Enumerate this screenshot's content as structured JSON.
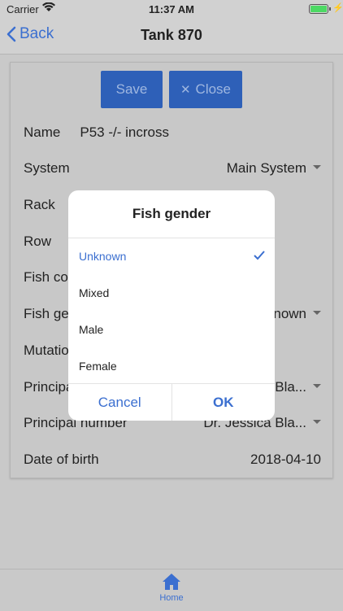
{
  "status": {
    "carrier": "Carrier",
    "time": "11:37 AM"
  },
  "nav": {
    "back_label": "Back",
    "title": "Tank 870"
  },
  "form": {
    "save_label": "Save",
    "close_label": "Close",
    "fields": [
      {
        "label": "Name",
        "value": "P53 -/- incross"
      },
      {
        "label": "System",
        "value": "Main System"
      },
      {
        "label": "Rack",
        "value": ""
      },
      {
        "label": "Row",
        "value": ""
      },
      {
        "label": "Fish co",
        "value": ""
      },
      {
        "label": "Fish ge",
        "value": "nown"
      },
      {
        "label": "Mutatio",
        "value": ""
      },
      {
        "label": "Principa",
        "value": "Bla..."
      },
      {
        "label": "Principal number",
        "value": "Dr. Jessica Bla..."
      },
      {
        "label": "Date of birth",
        "value": "2018-04-10"
      }
    ]
  },
  "dialog": {
    "title": "Fish gender",
    "options": [
      "Unknown",
      "Mixed",
      "Male",
      "Female"
    ],
    "selected_index": 0,
    "cancel_label": "Cancel",
    "ok_label": "OK"
  },
  "tabbar": {
    "home_label": "Home"
  },
  "colors": {
    "accent": "#3b6fd0",
    "button_bg": "#2e60b8"
  }
}
